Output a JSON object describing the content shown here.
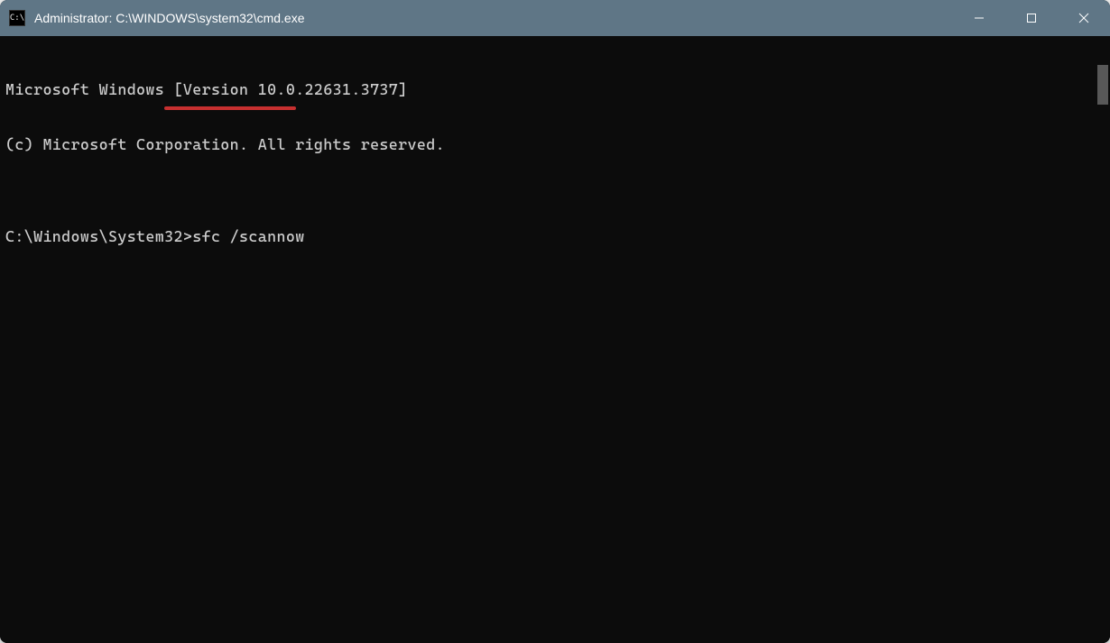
{
  "window": {
    "title": "Administrator: C:\\WINDOWS\\system32\\cmd.exe",
    "app_icon_label": "C:\\"
  },
  "console": {
    "lines": [
      "Microsoft Windows [Version 10.0.22631.3737]",
      "(c) Microsoft Corporation. All rights reserved.",
      "",
      "C:\\Windows\\System32>sfc /scannow"
    ],
    "prompt": "C:\\Windows\\System32>",
    "command": "sfc /scannow"
  },
  "annotation": {
    "type": "underline",
    "color": "#c73030",
    "target_text": "sfc /scannow"
  },
  "colors": {
    "titlebar_bg": "#5f7686",
    "console_bg": "#0c0c0c",
    "console_fg": "#cccccc"
  }
}
